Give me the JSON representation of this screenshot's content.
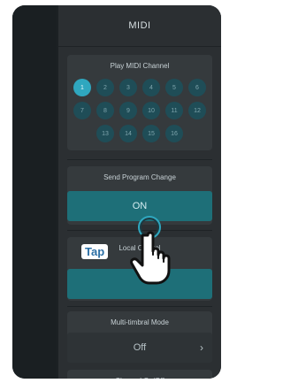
{
  "panel": {
    "title": "MIDI",
    "sections": {
      "play_channel": {
        "title": "Play MIDI Channel",
        "channels": [
          "1",
          "2",
          "3",
          "4",
          "5",
          "6",
          "7",
          "8",
          "9",
          "10",
          "11",
          "12",
          "13",
          "14",
          "15",
          "16"
        ],
        "selected": "1"
      },
      "send_program_change": {
        "title": "Send Program Change",
        "value": "ON"
      },
      "local_control": {
        "title": "Local Control",
        "value": ""
      },
      "multi_timbral": {
        "title": "Multi-timbral Mode",
        "value": "Off"
      },
      "channel_onoff": {
        "title": "Channel On/Off"
      }
    }
  },
  "overlay": {
    "tap_label": "Tap"
  },
  "colors": {
    "accent": "#2fa7bf",
    "teal": "#1e6f78",
    "panel": "#2b2f32"
  }
}
